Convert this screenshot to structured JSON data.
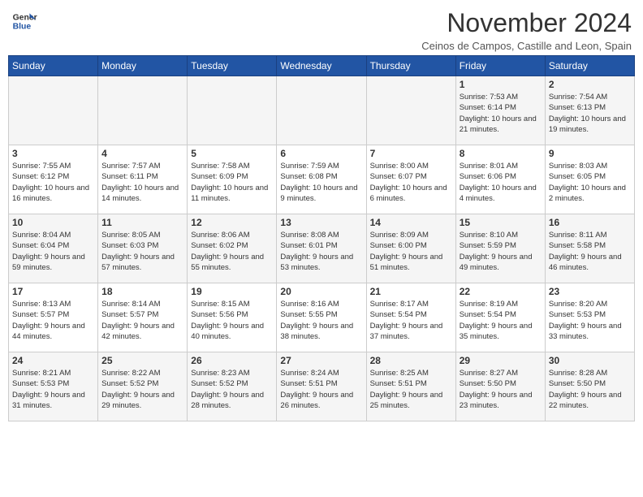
{
  "header": {
    "logo_line1": "General",
    "logo_line2": "Blue",
    "month": "November 2024",
    "location": "Ceinos de Campos, Castille and Leon, Spain"
  },
  "weekdays": [
    "Sunday",
    "Monday",
    "Tuesday",
    "Wednesday",
    "Thursday",
    "Friday",
    "Saturday"
  ],
  "weeks": [
    [
      {
        "day": "",
        "info": ""
      },
      {
        "day": "",
        "info": ""
      },
      {
        "day": "",
        "info": ""
      },
      {
        "day": "",
        "info": ""
      },
      {
        "day": "",
        "info": ""
      },
      {
        "day": "1",
        "info": "Sunrise: 7:53 AM\nSunset: 6:14 PM\nDaylight: 10 hours and 21 minutes."
      },
      {
        "day": "2",
        "info": "Sunrise: 7:54 AM\nSunset: 6:13 PM\nDaylight: 10 hours and 19 minutes."
      }
    ],
    [
      {
        "day": "3",
        "info": "Sunrise: 7:55 AM\nSunset: 6:12 PM\nDaylight: 10 hours and 16 minutes."
      },
      {
        "day": "4",
        "info": "Sunrise: 7:57 AM\nSunset: 6:11 PM\nDaylight: 10 hours and 14 minutes."
      },
      {
        "day": "5",
        "info": "Sunrise: 7:58 AM\nSunset: 6:09 PM\nDaylight: 10 hours and 11 minutes."
      },
      {
        "day": "6",
        "info": "Sunrise: 7:59 AM\nSunset: 6:08 PM\nDaylight: 10 hours and 9 minutes."
      },
      {
        "day": "7",
        "info": "Sunrise: 8:00 AM\nSunset: 6:07 PM\nDaylight: 10 hours and 6 minutes."
      },
      {
        "day": "8",
        "info": "Sunrise: 8:01 AM\nSunset: 6:06 PM\nDaylight: 10 hours and 4 minutes."
      },
      {
        "day": "9",
        "info": "Sunrise: 8:03 AM\nSunset: 6:05 PM\nDaylight: 10 hours and 2 minutes."
      }
    ],
    [
      {
        "day": "10",
        "info": "Sunrise: 8:04 AM\nSunset: 6:04 PM\nDaylight: 9 hours and 59 minutes."
      },
      {
        "day": "11",
        "info": "Sunrise: 8:05 AM\nSunset: 6:03 PM\nDaylight: 9 hours and 57 minutes."
      },
      {
        "day": "12",
        "info": "Sunrise: 8:06 AM\nSunset: 6:02 PM\nDaylight: 9 hours and 55 minutes."
      },
      {
        "day": "13",
        "info": "Sunrise: 8:08 AM\nSunset: 6:01 PM\nDaylight: 9 hours and 53 minutes."
      },
      {
        "day": "14",
        "info": "Sunrise: 8:09 AM\nSunset: 6:00 PM\nDaylight: 9 hours and 51 minutes."
      },
      {
        "day": "15",
        "info": "Sunrise: 8:10 AM\nSunset: 5:59 PM\nDaylight: 9 hours and 49 minutes."
      },
      {
        "day": "16",
        "info": "Sunrise: 8:11 AM\nSunset: 5:58 PM\nDaylight: 9 hours and 46 minutes."
      }
    ],
    [
      {
        "day": "17",
        "info": "Sunrise: 8:13 AM\nSunset: 5:57 PM\nDaylight: 9 hours and 44 minutes."
      },
      {
        "day": "18",
        "info": "Sunrise: 8:14 AM\nSunset: 5:57 PM\nDaylight: 9 hours and 42 minutes."
      },
      {
        "day": "19",
        "info": "Sunrise: 8:15 AM\nSunset: 5:56 PM\nDaylight: 9 hours and 40 minutes."
      },
      {
        "day": "20",
        "info": "Sunrise: 8:16 AM\nSunset: 5:55 PM\nDaylight: 9 hours and 38 minutes."
      },
      {
        "day": "21",
        "info": "Sunrise: 8:17 AM\nSunset: 5:54 PM\nDaylight: 9 hours and 37 minutes."
      },
      {
        "day": "22",
        "info": "Sunrise: 8:19 AM\nSunset: 5:54 PM\nDaylight: 9 hours and 35 minutes."
      },
      {
        "day": "23",
        "info": "Sunrise: 8:20 AM\nSunset: 5:53 PM\nDaylight: 9 hours and 33 minutes."
      }
    ],
    [
      {
        "day": "24",
        "info": "Sunrise: 8:21 AM\nSunset: 5:53 PM\nDaylight: 9 hours and 31 minutes."
      },
      {
        "day": "25",
        "info": "Sunrise: 8:22 AM\nSunset: 5:52 PM\nDaylight: 9 hours and 29 minutes."
      },
      {
        "day": "26",
        "info": "Sunrise: 8:23 AM\nSunset: 5:52 PM\nDaylight: 9 hours and 28 minutes."
      },
      {
        "day": "27",
        "info": "Sunrise: 8:24 AM\nSunset: 5:51 PM\nDaylight: 9 hours and 26 minutes."
      },
      {
        "day": "28",
        "info": "Sunrise: 8:25 AM\nSunset: 5:51 PM\nDaylight: 9 hours and 25 minutes."
      },
      {
        "day": "29",
        "info": "Sunrise: 8:27 AM\nSunset: 5:50 PM\nDaylight: 9 hours and 23 minutes."
      },
      {
        "day": "30",
        "info": "Sunrise: 8:28 AM\nSunset: 5:50 PM\nDaylight: 9 hours and 22 minutes."
      }
    ]
  ]
}
